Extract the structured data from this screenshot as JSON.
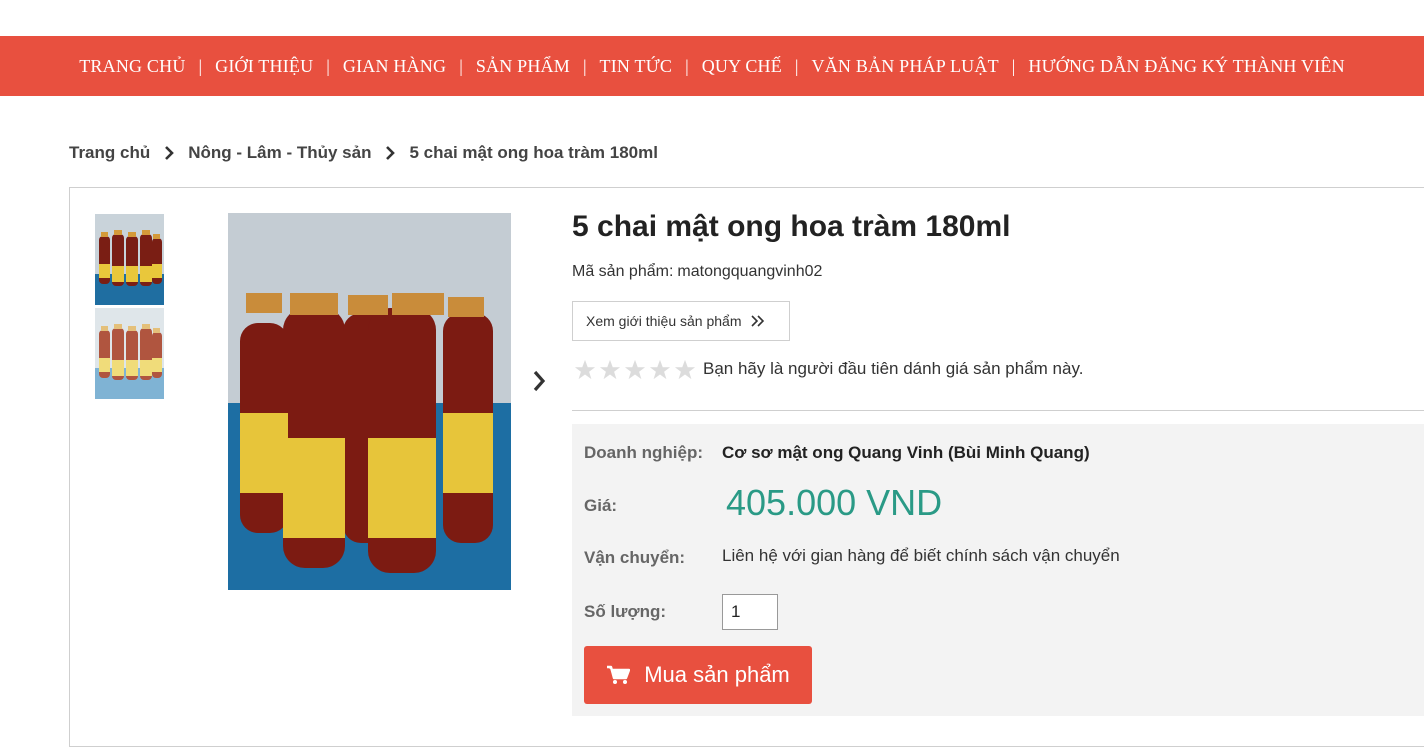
{
  "nav": {
    "items": [
      {
        "label": "TRANG CHỦ"
      },
      {
        "label": "GIỚI THIỆU"
      },
      {
        "label": "GIAN HÀNG"
      },
      {
        "label": "SẢN PHẨM"
      },
      {
        "label": "TIN TỨC"
      },
      {
        "label": "QUY CHẾ"
      },
      {
        "label": "VĂN BẢN PHÁP LUẬT"
      },
      {
        "label": "HƯỚNG DẪN ĐĂNG KÝ THÀNH VIÊN"
      }
    ],
    "separator": "|"
  },
  "breadcrumb": {
    "home": "Trang chủ",
    "category": "Nông - Lâm - Thủy sản",
    "current": "5 chai mật ong hoa tràm 180ml"
  },
  "product": {
    "title": "5 chai mật ong hoa tràm 180ml",
    "sku_label": "Mã sản phẩm:",
    "sku": "matongquangvinh02",
    "intro_button": "Xem giới thiệu sản phẩm",
    "rating_value": 0,
    "rating_max": 5,
    "rating_text": "Bạn hãy là người đầu tiên dánh giá sản phẩm này."
  },
  "details": {
    "business_label": "Doanh nghiệp:",
    "business": "Cơ sơ mật ong Quang Vinh (Bùi Minh Quang)",
    "price_label": "Giá:",
    "price": "405.000 VND",
    "shipping_label": "Vận chuyển:",
    "shipping": "Liên hệ với gian hàng để biết chính sách vận chuyển",
    "qty_label": "Số lượng:",
    "qty": "1",
    "buy_button": "Mua sản phẩm"
  },
  "colors": {
    "brand": "#e8503f",
    "price": "#2a9a86"
  }
}
